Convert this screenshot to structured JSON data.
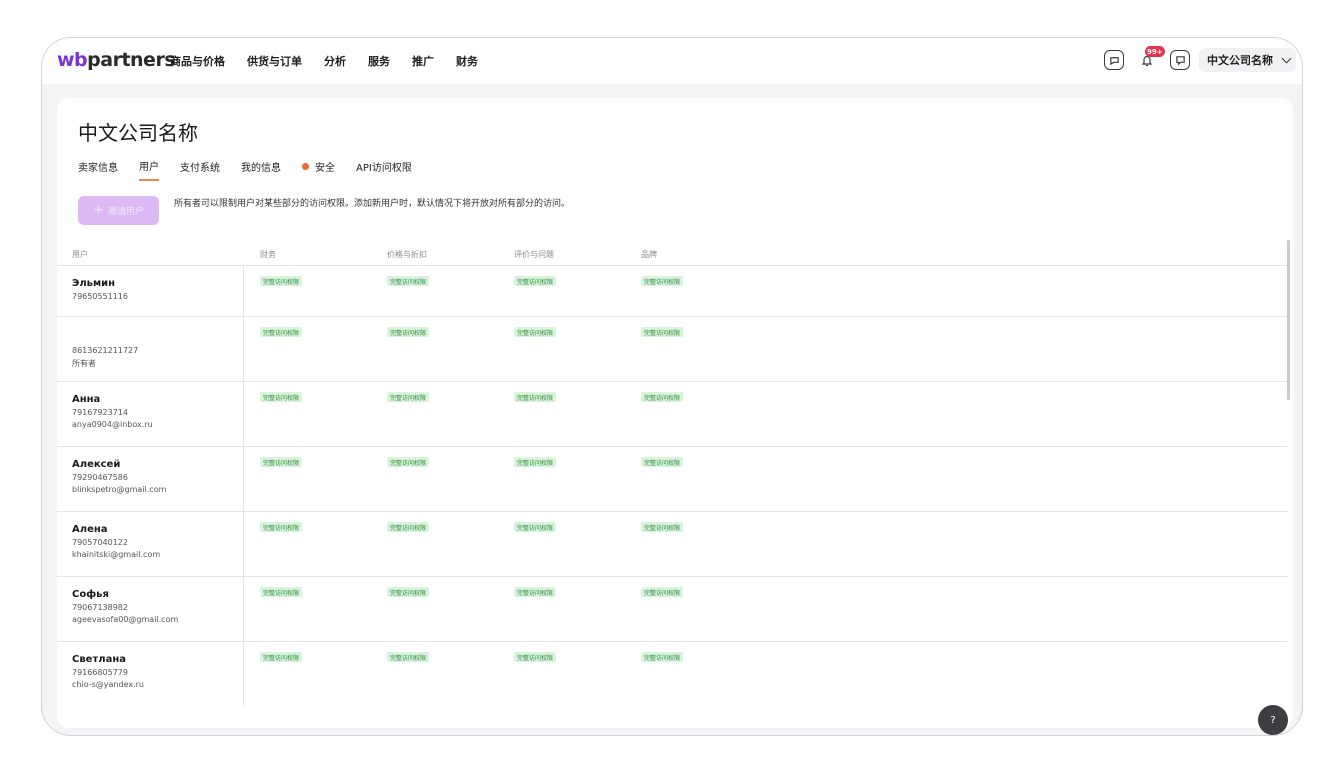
{
  "brand": {
    "logo_prefix": "wb",
    "logo_suffix": "partners"
  },
  "nav": {
    "items": [
      "商品与价格",
      "供货与订单",
      "分析",
      "服务",
      "推广",
      "财务"
    ]
  },
  "topbar": {
    "notification_count": "99+",
    "company_select": "中文公司名称"
  },
  "page": {
    "title": "中文公司名称",
    "tabs": [
      "卖家信息",
      "用户",
      "支付系统",
      "我的信息",
      "安全",
      "API访问权限"
    ],
    "active_tab": "用户",
    "invite_button": "邀请用户",
    "hint": "所有者可以限制用户对某些部分的访问权限。添加新用户时，默认情况下将开放对所有部分的访问。"
  },
  "table": {
    "headers": [
      "用户",
      "财务",
      "价格与折扣",
      "评价与问题",
      "品牌"
    ],
    "access_label": "完整访问权限",
    "rows": [
      {
        "name": "Эльмин",
        "phone": "79650551116",
        "email": "",
        "role": ""
      },
      {
        "name": "",
        "phone": "8613621211727",
        "email": "",
        "role": "所有者"
      },
      {
        "name": "Анна",
        "phone": "79167923714",
        "email": "anya0904@inbox.ru",
        "role": ""
      },
      {
        "name": "Алексей",
        "phone": "79290467586",
        "email": "blinkspetro@gmail.com",
        "role": ""
      },
      {
        "name": "Алена",
        "phone": "79057040122",
        "email": "khainitski@gmail.com",
        "role": ""
      },
      {
        "name": "Софья",
        "phone": "79067138982",
        "email": "ageevasofa00@gmail.com",
        "role": ""
      },
      {
        "name": "Светлана",
        "phone": "79166805779",
        "email": "chio-s@yandex.ru",
        "role": ""
      }
    ]
  },
  "help": {
    "label": "?"
  },
  "colors": {
    "accent": "#7a33d6",
    "tab_underline": "#e58a4c",
    "tag_bg": "#d9f3dc",
    "tag_text": "#2e8a3e",
    "invite_bg": "#dcb9f2",
    "badge": "#e5334b"
  }
}
